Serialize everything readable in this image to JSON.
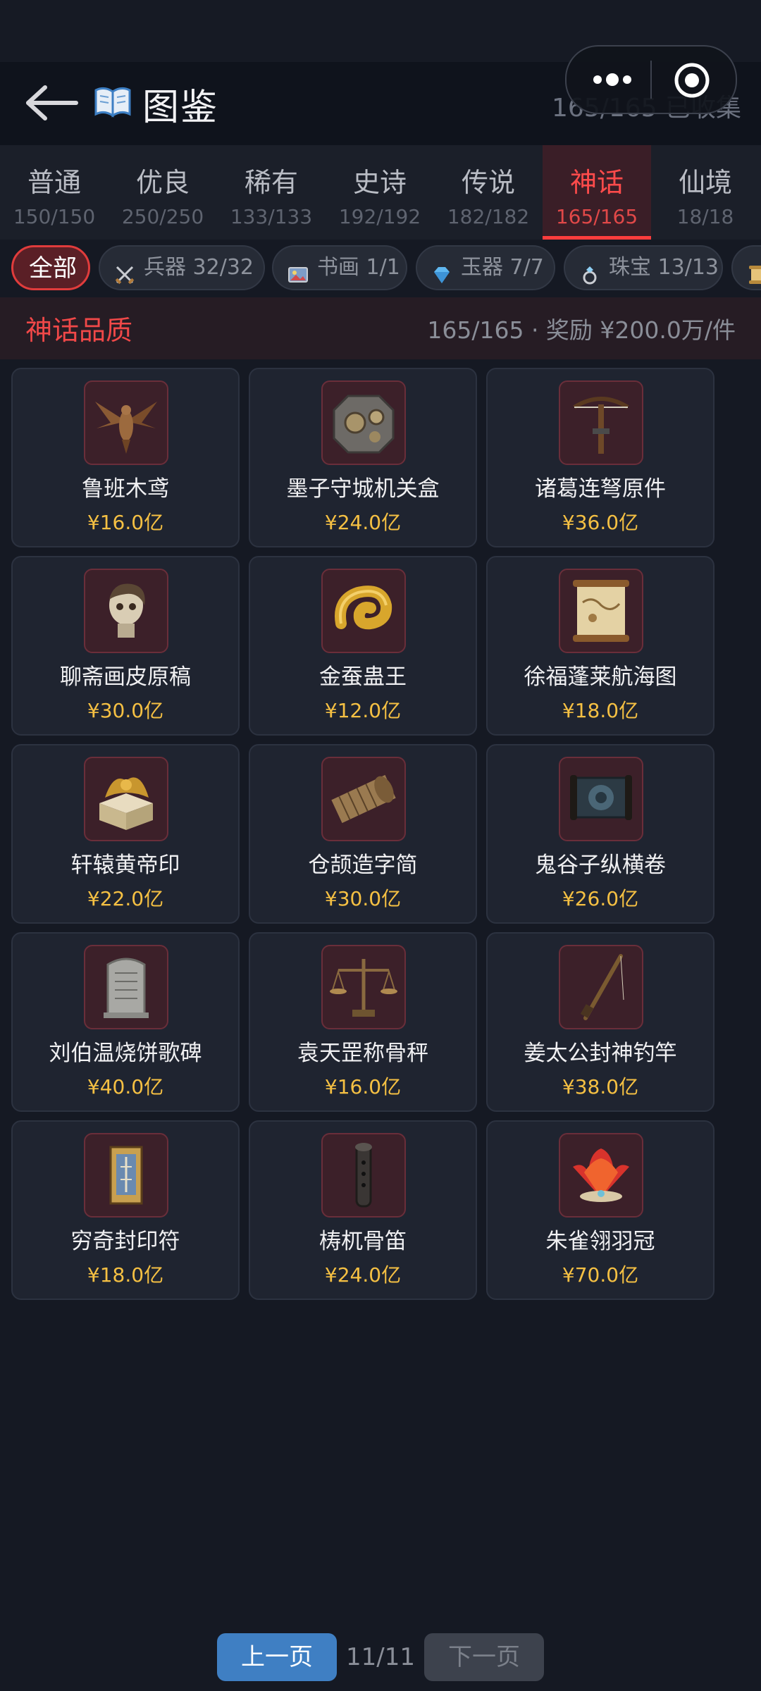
{
  "header": {
    "back_label": "back",
    "icon": "book-icon",
    "title": "图鉴",
    "collected": "165/165 已收集"
  },
  "capsule": {
    "more_icon": "more-icon",
    "close_icon": "target-close-icon"
  },
  "tabs": [
    {
      "label": "普通",
      "count": "150/150",
      "active": false
    },
    {
      "label": "优良",
      "count": "250/250",
      "active": false
    },
    {
      "label": "稀有",
      "count": "133/133",
      "active": false
    },
    {
      "label": "史诗",
      "count": "192/192",
      "active": false
    },
    {
      "label": "传说",
      "count": "182/182",
      "active": false
    },
    {
      "label": "神话",
      "count": "165/165",
      "active": true
    },
    {
      "label": "仙境",
      "count": "18/18",
      "active": false
    }
  ],
  "chips": [
    {
      "label": "全部",
      "icon": "",
      "active": true
    },
    {
      "label": "兵器 32/32",
      "icon": "swords-icon",
      "active": false
    },
    {
      "label": "书画 1/1",
      "icon": "picture-icon",
      "active": false
    },
    {
      "label": "玉器 7/7",
      "icon": "gem-icon",
      "active": false
    },
    {
      "label": "珠宝 13/13",
      "icon": "ring-icon",
      "active": false
    },
    {
      "label": "",
      "icon": "scroll-icon",
      "active": false
    }
  ],
  "quality": {
    "title": "神话品质",
    "summary": "165/165 · 奖励 ¥200.0万/件"
  },
  "items": [
    {
      "name": "鲁班木鸢",
      "price": "¥16.0亿",
      "icon": "wooden-kite-icon"
    },
    {
      "name": "墨子守城机关盒",
      "price": "¥24.0亿",
      "icon": "mechanism-box-icon"
    },
    {
      "name": "诸葛连弩原件",
      "price": "¥36.0亿",
      "icon": "crossbow-icon"
    },
    {
      "name": "聊斋画皮原稿",
      "price": "¥30.0亿",
      "icon": "skull-mask-icon"
    },
    {
      "name": "金蚕蛊王",
      "price": "¥12.0亿",
      "icon": "golden-worm-icon"
    },
    {
      "name": "徐福蓬莱航海图",
      "price": "¥18.0亿",
      "icon": "map-scroll-icon"
    },
    {
      "name": "轩辕黄帝印",
      "price": "¥22.0亿",
      "icon": "imperial-seal-icon"
    },
    {
      "name": "仓颉造字简",
      "price": "¥30.0亿",
      "icon": "bamboo-slips-icon"
    },
    {
      "name": "鬼谷子纵横卷",
      "price": "¥26.0亿",
      "icon": "dark-scroll-icon"
    },
    {
      "name": "刘伯温烧饼歌碑",
      "price": "¥40.0亿",
      "icon": "stone-tablet-icon"
    },
    {
      "name": "袁天罡称骨秤",
      "price": "¥16.0亿",
      "icon": "scale-icon"
    },
    {
      "name": "姜太公封神钓竿",
      "price": "¥38.0亿",
      "icon": "fishing-rod-icon"
    },
    {
      "name": "穷奇封印符",
      "price": "¥18.0亿",
      "icon": "talisman-icon"
    },
    {
      "name": "梼杌骨笛",
      "price": "¥24.0亿",
      "icon": "bone-flute-icon"
    },
    {
      "name": "朱雀翎羽冠",
      "price": "¥70.0亿",
      "icon": "feather-crown-icon"
    }
  ],
  "pager": {
    "prev": "上一页",
    "page": "11/11",
    "next": "下一页"
  }
}
